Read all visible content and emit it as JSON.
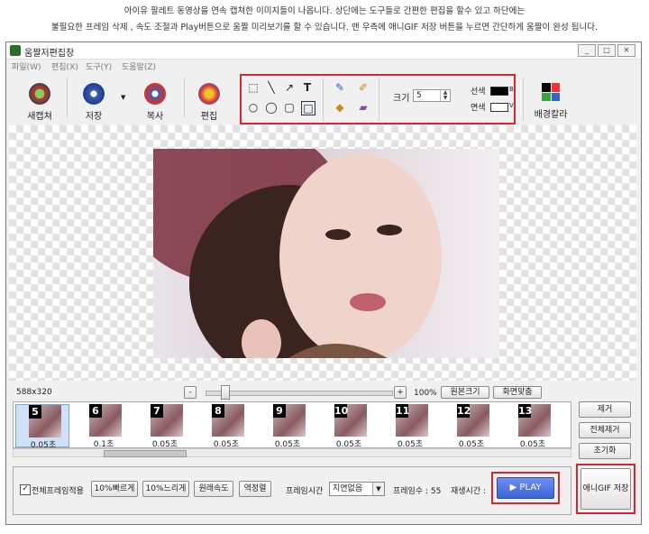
{
  "caption": {
    "line1": "아이유 팔레트 동영상을 연속 캡쳐한 이미지들이 나옵니다.  상단에는 도구들로 간편한 편집을 할수 있고  하단에는",
    "line2": "불필요한 프레임 삭제 , 속도 조절과  Play버튼으로 움짤 미리보기를 할 수 있습니다. 맨 우측에  애니GIF 저장 버튼을 누르면 간단하게 움짤이 완성 됩니다."
  },
  "window": {
    "title": "움짤저편집창",
    "controls": [
      "_",
      "□",
      "✕"
    ]
  },
  "menu": [
    "파일(W)",
    "편집(X)",
    "도구(Y)",
    "도움말(Z)"
  ],
  "toolbar": {
    "new": "새캡쳐",
    "save": "저장",
    "copy": "복사",
    "edit": "편집",
    "size_label": "크기",
    "size_value": "5",
    "line_color_label": "선색",
    "line_color_code": "B",
    "fill_color_label": "면색",
    "fill_color_code": "V",
    "bg_color": "배경칼라",
    "line_color": "#000000",
    "fill_color": "#ffffff"
  },
  "status": {
    "dimensions": "588x320",
    "zoom": "100%"
  },
  "zoom": {
    "minus": "-",
    "plus": "+",
    "original_size": "원본크기",
    "fit_screen": "화면맞춤"
  },
  "frames": [
    {
      "num": "5",
      "time": "0.05초"
    },
    {
      "num": "6",
      "time": "0.1초"
    },
    {
      "num": "7",
      "time": "0.05초"
    },
    {
      "num": "8",
      "time": "0.05초"
    },
    {
      "num": "9",
      "time": "0.05초"
    },
    {
      "num": "10",
      "time": "0.05초"
    },
    {
      "num": "11",
      "time": "0.05초"
    },
    {
      "num": "12",
      "time": "0.05초"
    },
    {
      "num": "13",
      "time": "0.05초"
    }
  ],
  "side_buttons": {
    "remove": "제거",
    "remove_all": "전체제거",
    "reset": "초기화"
  },
  "bottom": {
    "apply_all": "전체프레임적용",
    "faster": "10%빠르게",
    "slower": "10%느리게",
    "original_speed": "원래속도",
    "reverse": "역정렬",
    "frame_time_label": "프레임시간",
    "frame_time_value": "지연없음",
    "frame_count_label": "프레임수 : 55",
    "play_time_label": "재생시간 :",
    "play": "▶ PLAY",
    "save_gif": "애니GIF 저장"
  },
  "colors": {
    "accent_red": "#d9262e",
    "play_blue": "#3b66d6"
  }
}
